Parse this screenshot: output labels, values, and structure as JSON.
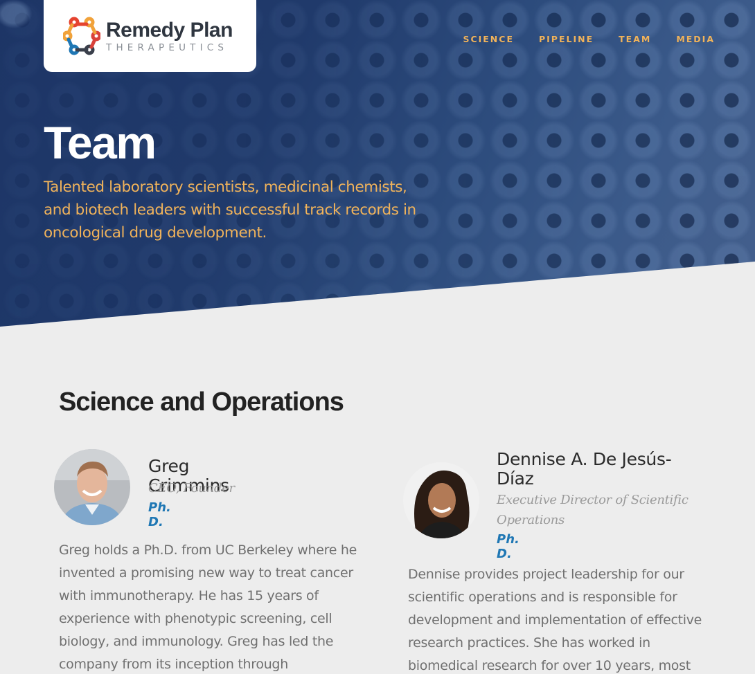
{
  "brand": {
    "name": "Remedy Plan",
    "sub": "THERAPEUTICS",
    "colors": {
      "navy": "#1d3566",
      "accent": "#f1b35a",
      "degree_blue": "#1f77b4"
    }
  },
  "nav": {
    "items": [
      {
        "label": "SCIENCE"
      },
      {
        "label": "PIPELINE"
      },
      {
        "label": "TEAM"
      },
      {
        "label": "MEDIA"
      }
    ]
  },
  "hero": {
    "title": "Team",
    "subtitle": "Talented laboratory scientists, medicinal chemists, and biotech leaders with successful track records in oncological drug development."
  },
  "section": {
    "title": "Science and Operations",
    "members": [
      {
        "name": "Greg Crimmins",
        "role": "CEO, Founder",
        "degree": "Ph. D.",
        "bio": "Greg holds a Ph.D. from UC Berkeley where he invented a promising new way to treat cancer with immunotherapy. He has 15 years of experience with phenotypic screening, cell biology, and immunology. Greg has led the company from its inception through"
      },
      {
        "name": "Dennise A. De Jesús-Díaz",
        "role": "Executive Director of Scientific Operations",
        "degree": "Ph. D.",
        "bio": "Dennise provides project leadership for our scientific operations and is responsible for development and implementation of effective research practices. She has worked in biomedical research for over 10 years, most"
      }
    ]
  }
}
